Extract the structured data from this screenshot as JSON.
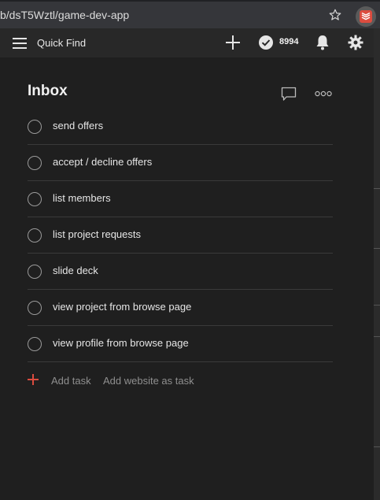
{
  "browser": {
    "url": "b/dsT5Wztl/game-dev-app"
  },
  "appbar": {
    "quick_find_label": "Quick Find",
    "karma_count": "8994"
  },
  "inbox": {
    "title": "Inbox",
    "tasks": [
      {
        "label": "send offers"
      },
      {
        "label": "accept / decline offers"
      },
      {
        "label": "list members"
      },
      {
        "label": "list project requests"
      },
      {
        "label": "slide deck"
      },
      {
        "label": "view project from browse page"
      },
      {
        "label": "view profile from browse page"
      }
    ],
    "add_task_label": "Add task",
    "add_website_label": "Add website as task"
  },
  "colors": {
    "accent": "#db4c3f",
    "background": "#1f1f1f",
    "appbar": "#282828"
  },
  "icons": {
    "menu": "hamburger-icon",
    "add": "plus-icon",
    "karma": "check-circle-icon",
    "notifications": "bell-icon",
    "settings": "gear-icon",
    "comments": "comment-icon",
    "more": "more-dots-icon",
    "bookmark": "star-icon",
    "extension": "todoist-icon"
  }
}
